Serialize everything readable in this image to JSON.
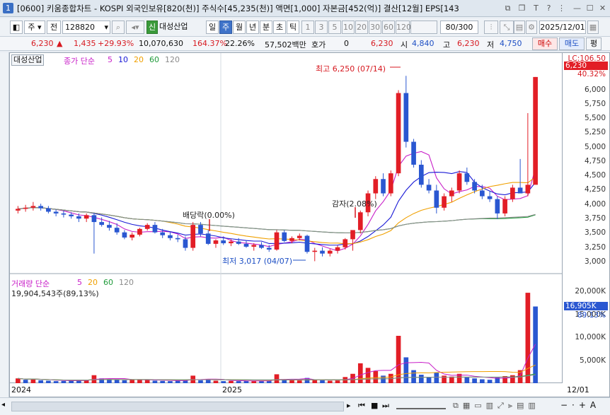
{
  "window": {
    "badge": "1",
    "title": "[0600] 키움종합차트 - KOSPI 외국인보유[820(천)] 주식수[45,235(천)] 액면[1,000] 자본금[452(억)] 결산[12월] EPS[143"
  },
  "toolbar": {
    "period_type": "주",
    "period_mode": "전",
    "stock_code": "128820",
    "credit_badge": "신",
    "stock_name": "대성산업",
    "periods": [
      "일",
      "주",
      "월",
      "년",
      "분",
      "초",
      "틱"
    ],
    "selected_period": "주",
    "intervals": [
      "1",
      "3",
      "5",
      "10",
      "20",
      "30",
      "60",
      "120"
    ],
    "count": "80",
    "total": "/300",
    "date": "2025/12/01"
  },
  "quote": {
    "price": "6,230",
    "change": "1,435",
    "change_pct": "+29.93%",
    "volume": "10,070,630",
    "vol_ratio": "164.37%",
    "turnover": "22.26%",
    "amount": "57,502백만",
    "hoga_label": "호가",
    "hoga_value": "0",
    "hoga_price": "6,230",
    "open_label": "시",
    "open": "4,840",
    "high_label": "고",
    "high": "6,230",
    "low_label": "저",
    "low": "4,750",
    "buy_label": "매수",
    "sell_label": "매도",
    "eval_label": "평"
  },
  "price_panel": {
    "name_tag": "대성산업",
    "legend_main": "종가 단순",
    "ma": [
      {
        "label": "5",
        "color": "#c81fc8"
      },
      {
        "label": "10",
        "color": "#1a1ad6"
      },
      {
        "label": "20",
        "color": "#f0a000"
      },
      {
        "label": "60",
        "color": "#1f9a3a"
      },
      {
        "label": "120",
        "color": "#8c8c8c"
      }
    ],
    "high_annotation": "최고 6,250 (07/14)",
    "low_annotation": "최저 3,017 (04/07)",
    "dividend_annotation": "배당락(0.00%)",
    "capital_reduction_annotation": "감자(2.08%)",
    "lc_label": "LC:106.50",
    "current_price_label": "6,230",
    "current_pct_label": "40.32%",
    "y_ticks": [
      "6,000",
      "5,750",
      "5,500",
      "5,250",
      "5,000",
      "4,750",
      "4,500",
      "4,250",
      "4,000",
      "3,750",
      "3,500",
      "3,250",
      "3,000"
    ]
  },
  "volume_panel": {
    "legend": "거래량 단순",
    "ma_labels": [
      "5",
      "20",
      "60",
      "120"
    ],
    "max_label": "19,904,543주(89,13%)",
    "y_ticks": [
      "20,000K",
      "15,000K",
      "10,000K",
      "5,000K"
    ],
    "current_label": "16,905K",
    "current_pct": "89.13%"
  },
  "date_axis": {
    "labels": [
      "2024",
      "2025"
    ],
    "last": "12/01"
  },
  "chart_data": {
    "type": "candlestick",
    "up_color": "#e21e26",
    "down_color": "#2a57d1",
    "ylim": [
      2850,
      6500
    ],
    "candles": [
      [
        3900,
        3980,
        3850,
        3930
      ],
      [
        3930,
        4000,
        3880,
        3950
      ],
      [
        3950,
        4050,
        3900,
        3980
      ],
      [
        3980,
        4020,
        3900,
        3940
      ],
      [
        3940,
        3980,
        3850,
        3880
      ],
      [
        3880,
        3920,
        3800,
        3850
      ],
      [
        3850,
        3900,
        3780,
        3830
      ],
      [
        3830,
        3870,
        3760,
        3800
      ],
      [
        3800,
        3850,
        3700,
        3760
      ],
      [
        3760,
        3850,
        3700,
        3820
      ],
      [
        3820,
        3860,
        3150,
        3700
      ],
      [
        3700,
        3780,
        3620,
        3650
      ],
      [
        3650,
        3720,
        3550,
        3600
      ],
      [
        3600,
        3680,
        3480,
        3520
      ],
      [
        3520,
        3560,
        3400,
        3430
      ],
      [
        3430,
        3520,
        3380,
        3480
      ],
      [
        3480,
        3600,
        3450,
        3580
      ],
      [
        3580,
        3680,
        3550,
        3650
      ],
      [
        3650,
        3700,
        3500,
        3520
      ],
      [
        3520,
        3580,
        3420,
        3470
      ],
      [
        3470,
        3520,
        3380,
        3420
      ],
      [
        3420,
        3480,
        3350,
        3400
      ],
      [
        3400,
        3450,
        3200,
        3250
      ],
      [
        3250,
        3700,
        3200,
        3650
      ],
      [
        3650,
        3700,
        3450,
        3500
      ],
      [
        3500,
        3560,
        3300,
        3320
      ],
      [
        3320,
        3400,
        3250,
        3380
      ],
      [
        3380,
        3450,
        3300,
        3330
      ],
      [
        3330,
        3400,
        3280,
        3360
      ],
      [
        3360,
        3420,
        3300,
        3320
      ],
      [
        3320,
        3380,
        3250,
        3270
      ],
      [
        3270,
        3330,
        3200,
        3300
      ],
      [
        3300,
        3350,
        3230,
        3250
      ],
      [
        3250,
        3300,
        3180,
        3220
      ],
      [
        3220,
        3560,
        3200,
        3520
      ],
      [
        3520,
        3560,
        3350,
        3370
      ],
      [
        3370,
        3450,
        3330,
        3420
      ],
      [
        3420,
        3500,
        3380,
        3460
      ],
      [
        3460,
        3480,
        3150,
        3180
      ],
      [
        3180,
        3250,
        3017,
        3200
      ],
      [
        3200,
        3260,
        3100,
        3150
      ],
      [
        3150,
        3230,
        3100,
        3200
      ],
      [
        3200,
        3290,
        3150,
        3260
      ],
      [
        3260,
        3420,
        3220,
        3400
      ],
      [
        3400,
        3480,
        3200,
        3560
      ],
      [
        3560,
        3900,
        3500,
        3870
      ],
      [
        3870,
        4250,
        3800,
        4200
      ],
      [
        4200,
        4500,
        4100,
        4450
      ],
      [
        4450,
        4550,
        4150,
        4200
      ],
      [
        4200,
        4600,
        4150,
        4550
      ],
      [
        4550,
        6000,
        4500,
        5950
      ],
      [
        5950,
        6250,
        5000,
        5100
      ],
      [
        5100,
        5150,
        4650,
        4700
      ],
      [
        4700,
        4780,
        4300,
        4350
      ],
      [
        4350,
        4450,
        4200,
        4250
      ],
      [
        4250,
        4350,
        3850,
        3950
      ],
      [
        3950,
        4200,
        3900,
        4150
      ],
      [
        4150,
        4300,
        4050,
        4250
      ],
      [
        4250,
        4600,
        4200,
        4550
      ],
      [
        4550,
        4650,
        4350,
        4400
      ],
      [
        4400,
        4450,
        4200,
        4250
      ],
      [
        4250,
        4350,
        4100,
        4150
      ],
      [
        4150,
        4250,
        4050,
        4100
      ],
      [
        4100,
        4150,
        3750,
        3850
      ],
      [
        3850,
        4150,
        3800,
        4100
      ],
      [
        4100,
        4350,
        4050,
        4300
      ],
      [
        4300,
        4800,
        4250,
        4200
      ],
      [
        4200,
        5600,
        4150,
        4350
      ],
      [
        4350,
        6230,
        4750,
        6230
      ]
    ],
    "volume": [
      [
        1200,
        1
      ],
      [
        900,
        0
      ],
      [
        1100,
        1
      ],
      [
        800,
        0
      ],
      [
        700,
        0
      ],
      [
        600,
        0
      ],
      [
        650,
        0
      ],
      [
        700,
        0
      ],
      [
        900,
        0
      ],
      [
        800,
        1
      ],
      [
        1900,
        1
      ],
      [
        1200,
        0
      ],
      [
        1000,
        0
      ],
      [
        900,
        0
      ],
      [
        800,
        0
      ],
      [
        850,
        1
      ],
      [
        1000,
        1
      ],
      [
        900,
        1
      ],
      [
        700,
        0
      ],
      [
        650,
        0
      ],
      [
        600,
        0
      ],
      [
        700,
        0
      ],
      [
        900,
        0
      ],
      [
        1800,
        1
      ],
      [
        800,
        0
      ],
      [
        1000,
        0
      ],
      [
        700,
        1
      ],
      [
        600,
        0
      ],
      [
        650,
        1
      ],
      [
        600,
        0
      ],
      [
        700,
        0
      ],
      [
        650,
        1
      ],
      [
        600,
        0
      ],
      [
        700,
        0
      ],
      [
        2100,
        1
      ],
      [
        900,
        0
      ],
      [
        800,
        1
      ],
      [
        750,
        1
      ],
      [
        1300,
        0
      ],
      [
        900,
        1
      ],
      [
        800,
        0
      ],
      [
        700,
        1
      ],
      [
        750,
        1
      ],
      [
        1500,
        1
      ],
      [
        2200,
        1
      ],
      [
        4500,
        1
      ],
      [
        3500,
        1
      ],
      [
        2800,
        1
      ],
      [
        1800,
        0
      ],
      [
        2200,
        1
      ],
      [
        10500,
        1
      ],
      [
        5800,
        0
      ],
      [
        3000,
        0
      ],
      [
        2000,
        0
      ],
      [
        1500,
        0
      ],
      [
        2500,
        0
      ],
      [
        1800,
        1
      ],
      [
        1600,
        1
      ],
      [
        2200,
        1
      ],
      [
        1500,
        0
      ],
      [
        1200,
        0
      ],
      [
        1000,
        0
      ],
      [
        900,
        0
      ],
      [
        1500,
        0
      ],
      [
        1700,
        1
      ],
      [
        1900,
        1
      ],
      [
        3000,
        1
      ],
      [
        19904,
        1
      ],
      [
        16905,
        0
      ]
    ]
  }
}
